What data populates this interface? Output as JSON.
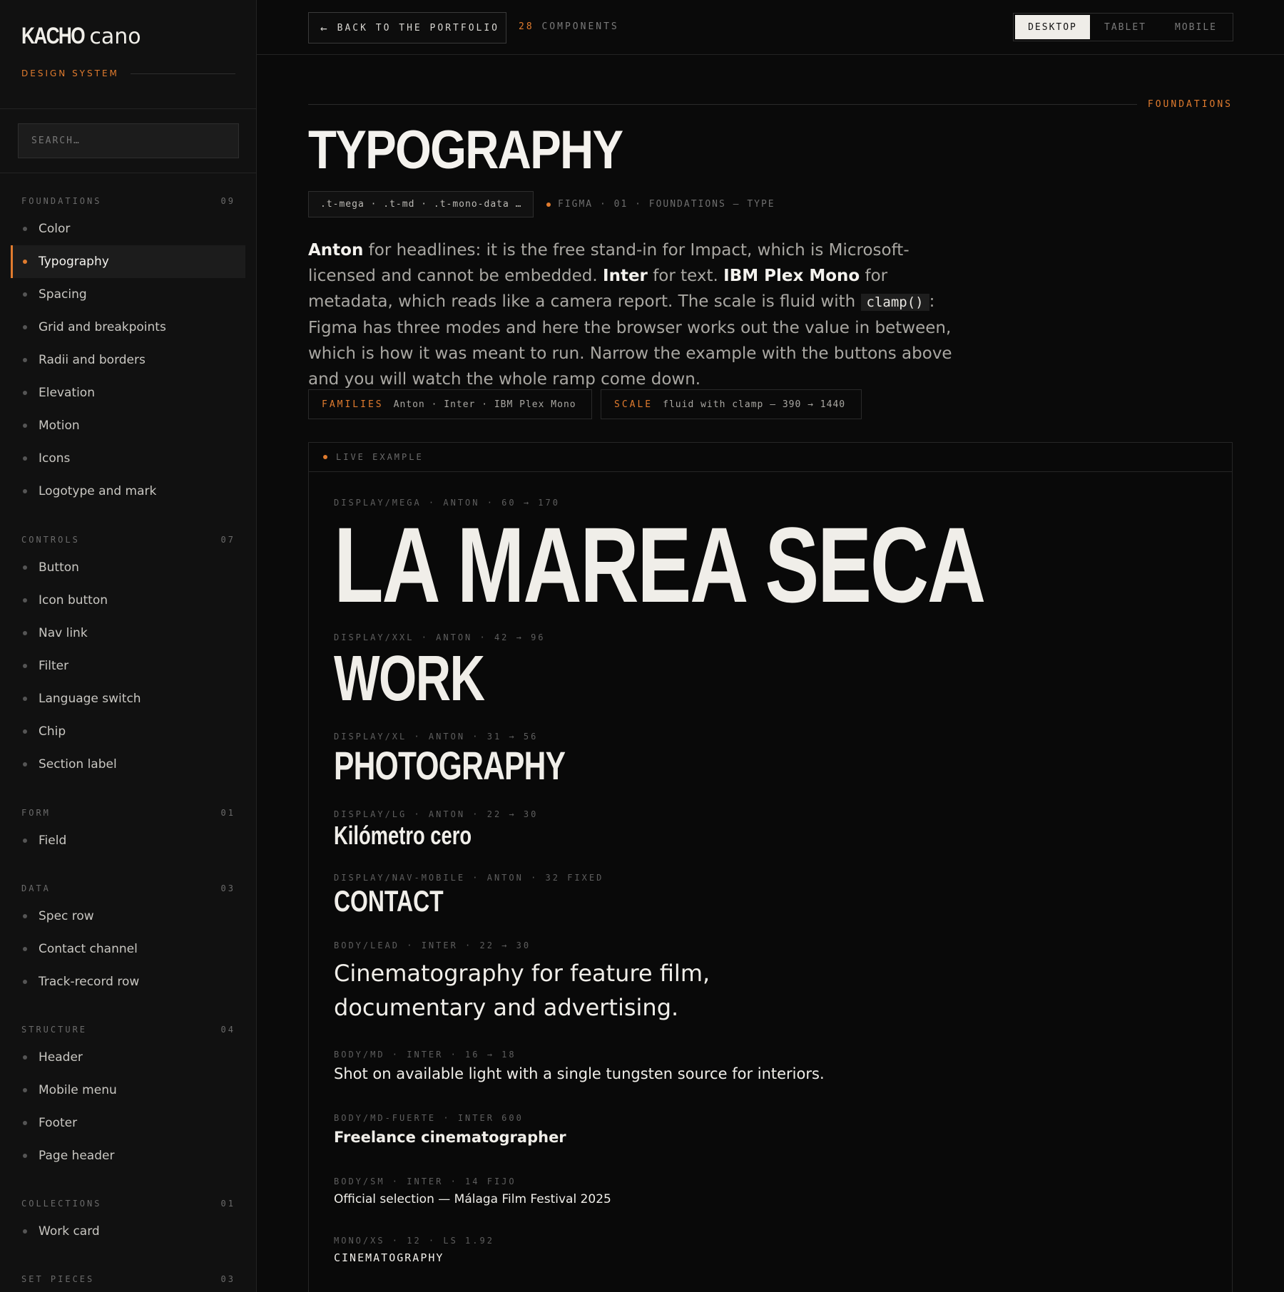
{
  "sidebar": {
    "logo_bold": "KACHO",
    "logo_light": "cano",
    "label": "DESIGN SYSTEM",
    "search_placeholder": "SEARCH…",
    "sections": [
      {
        "title": "FOUNDATIONS",
        "count": "09",
        "items": [
          "Color",
          "Typography",
          "Spacing",
          "Grid and breakpoints",
          "Radii and borders",
          "Elevation",
          "Motion",
          "Icons",
          "Logotype and mark"
        ]
      },
      {
        "title": "CONTROLS",
        "count": "07",
        "items": [
          "Button",
          "Icon button",
          "Nav link",
          "Filter",
          "Language switch",
          "Chip",
          "Section label"
        ]
      },
      {
        "title": "FORM",
        "count": "01",
        "items": [
          "Field"
        ]
      },
      {
        "title": "DATA",
        "count": "03",
        "items": [
          "Spec row",
          "Contact channel",
          "Track-record row"
        ]
      },
      {
        "title": "STRUCTURE",
        "count": "04",
        "items": [
          "Header",
          "Mobile menu",
          "Footer",
          "Page header"
        ]
      },
      {
        "title": "COLLECTIONS",
        "count": "01",
        "items": [
          "Work card"
        ]
      },
      {
        "title": "SET PIECES",
        "count": "03",
        "items": []
      }
    ],
    "active_item": "Typography"
  },
  "topbar": {
    "back_label": "BACK TO THE PORTFOLIO",
    "count_num": "28",
    "count_label": "COMPONENTS",
    "viewports": [
      "DESKTOP",
      "TABLET",
      "MOBILE"
    ],
    "active_viewport": "DESKTOP"
  },
  "main": {
    "section_tag": "FOUNDATIONS",
    "title": "TYPOGRAPHY",
    "classes": ".t-mega · .t-md · .t-mono-data …",
    "figma_ref": "FIGMA · 01 · FOUNDATIONS — TYPE",
    "intro": {
      "anton": "Anton",
      "p1": " for headlines: it is the free stand-in for Impact, which is Microsoft-licensed and cannot be embedded. ",
      "inter": "Inter",
      "p2": " for text. ",
      "plex": "IBM Plex Mono",
      "p3": " for metadata, which reads like a camera report. The scale is fluid with ",
      "code": "clamp()",
      "p4": ": Figma has three modes and here the browser works out the value in between, which is how it was meant to run. Narrow the example with the buttons above and you will watch the whole ramp come down."
    },
    "families_key": "FAMILIES",
    "families_val": "Anton · Inter · IBM Plex Mono",
    "scale_key": "SCALE",
    "scale_val": "fluid with clamp — 390 → 1440"
  },
  "example": {
    "label": "LIVE EXAMPLE",
    "samples": [
      {
        "spec": "DISPLAY/MEGA · ANTON · 60 → 170",
        "text": "LA MAREA SECA"
      },
      {
        "spec": "DISPLAY/XXL · ANTON · 42 → 96",
        "text": "WORK"
      },
      {
        "spec": "DISPLAY/XL · ANTON · 31 → 56",
        "text": "PHOTOGRAPHY"
      },
      {
        "spec": "DISPLAY/LG · ANTON · 22 → 30",
        "text": "Kilómetro cero"
      },
      {
        "spec": "DISPLAY/NAV-MOBILE · ANTON · 32 FIXED",
        "text": "CONTACT"
      },
      {
        "spec": "BODY/LEAD · INTER · 22 → 30",
        "text_line1": "Cinematography for feature film,",
        "text_line2": "documentary and advertising."
      },
      {
        "spec": "BODY/MD · INTER · 16 → 18",
        "text": "Shot on available light with a single tungsten source for interiors."
      },
      {
        "spec": "BODY/MD-FUERTE · INTER 600",
        "text": "Freelance cinematographer"
      },
      {
        "spec": "BODY/SM · INTER · 14 FIJO",
        "text": "Official selection — Málaga Film Festival 2025"
      },
      {
        "spec": "MONO/XS · 12 · LS 1.92",
        "text": "CINEMATOGRAPHY"
      }
    ]
  }
}
